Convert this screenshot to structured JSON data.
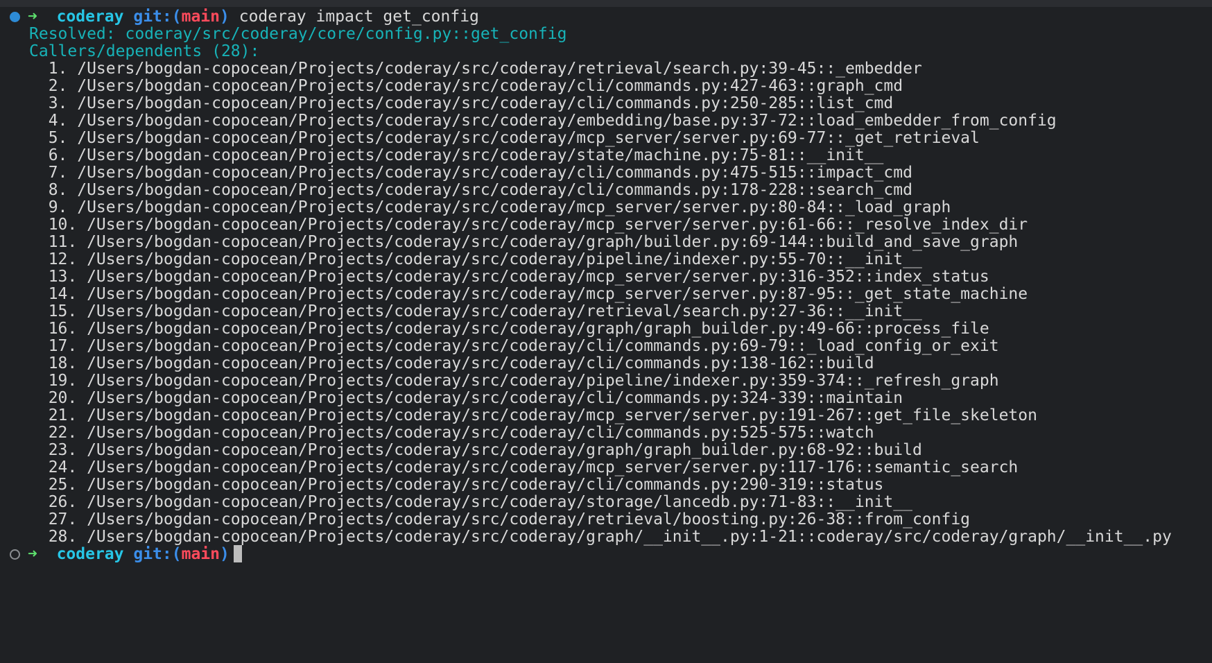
{
  "prompt": {
    "arrow": "➜",
    "dir": "coderay",
    "git_prefix": "git:(",
    "branch": "main",
    "git_suffix": ")",
    "command": "coderay impact get_config"
  },
  "output": {
    "resolved": "Resolved: coderay/src/coderay/core/config.py::get_config",
    "callers_header": "Callers/dependents (28):",
    "entries": [
      "  1. /Users/bogdan-copocean/Projects/coderay/src/coderay/retrieval/search.py:39-45::_embedder",
      "  2. /Users/bogdan-copocean/Projects/coderay/src/coderay/cli/commands.py:427-463::graph_cmd",
      "  3. /Users/bogdan-copocean/Projects/coderay/src/coderay/cli/commands.py:250-285::list_cmd",
      "  4. /Users/bogdan-copocean/Projects/coderay/src/coderay/embedding/base.py:37-72::load_embedder_from_config",
      "  5. /Users/bogdan-copocean/Projects/coderay/src/coderay/mcp_server/server.py:69-77::_get_retrieval",
      "  6. /Users/bogdan-copocean/Projects/coderay/src/coderay/state/machine.py:75-81::__init__",
      "  7. /Users/bogdan-copocean/Projects/coderay/src/coderay/cli/commands.py:475-515::impact_cmd",
      "  8. /Users/bogdan-copocean/Projects/coderay/src/coderay/cli/commands.py:178-228::search_cmd",
      "  9. /Users/bogdan-copocean/Projects/coderay/src/coderay/mcp_server/server.py:80-84::_load_graph",
      "  10. /Users/bogdan-copocean/Projects/coderay/src/coderay/mcp_server/server.py:61-66::_resolve_index_dir",
      "  11. /Users/bogdan-copocean/Projects/coderay/src/coderay/graph/builder.py:69-144::build_and_save_graph",
      "  12. /Users/bogdan-copocean/Projects/coderay/src/coderay/pipeline/indexer.py:55-70::__init__",
      "  13. /Users/bogdan-copocean/Projects/coderay/src/coderay/mcp_server/server.py:316-352::index_status",
      "  14. /Users/bogdan-copocean/Projects/coderay/src/coderay/mcp_server/server.py:87-95::_get_state_machine",
      "  15. /Users/bogdan-copocean/Projects/coderay/src/coderay/retrieval/search.py:27-36::__init__",
      "  16. /Users/bogdan-copocean/Projects/coderay/src/coderay/graph/graph_builder.py:49-66::process_file",
      "  17. /Users/bogdan-copocean/Projects/coderay/src/coderay/cli/commands.py:69-79::_load_config_or_exit",
      "  18. /Users/bogdan-copocean/Projects/coderay/src/coderay/cli/commands.py:138-162::build",
      "  19. /Users/bogdan-copocean/Projects/coderay/src/coderay/pipeline/indexer.py:359-374::_refresh_graph",
      "  20. /Users/bogdan-copocean/Projects/coderay/src/coderay/cli/commands.py:324-339::maintain",
      "  21. /Users/bogdan-copocean/Projects/coderay/src/coderay/mcp_server/server.py:191-267::get_file_skeleton",
      "  22. /Users/bogdan-copocean/Projects/coderay/src/coderay/cli/commands.py:525-575::watch",
      "  23. /Users/bogdan-copocean/Projects/coderay/src/coderay/graph/graph_builder.py:68-92::build",
      "  24. /Users/bogdan-copocean/Projects/coderay/src/coderay/mcp_server/server.py:117-176::semantic_search",
      "  25. /Users/bogdan-copocean/Projects/coderay/src/coderay/cli/commands.py:290-319::status",
      "  26. /Users/bogdan-copocean/Projects/coderay/src/coderay/storage/lancedb.py:71-83::__init__",
      "  27. /Users/bogdan-copocean/Projects/coderay/src/coderay/retrieval/boosting.py:26-38::from_config",
      "  28. /Users/bogdan-copocean/Projects/coderay/src/coderay/graph/__init__.py:1-21::coderay/src/coderay/graph/__init__.py"
    ]
  },
  "prompt2": {
    "arrow": "➜",
    "dir": "coderay",
    "git_prefix": "git:(",
    "branch": "main",
    "git_suffix": ")"
  },
  "colors": {
    "background": "#1f2124",
    "info_teal": "#17b3b8",
    "arrow_green": "#5ee06e",
    "dir_cyan": "#27c6e6",
    "git_blue": "#3b8eea",
    "branch_red": "#ff4b5c",
    "status_dot_blue": "#2d8bd6"
  }
}
